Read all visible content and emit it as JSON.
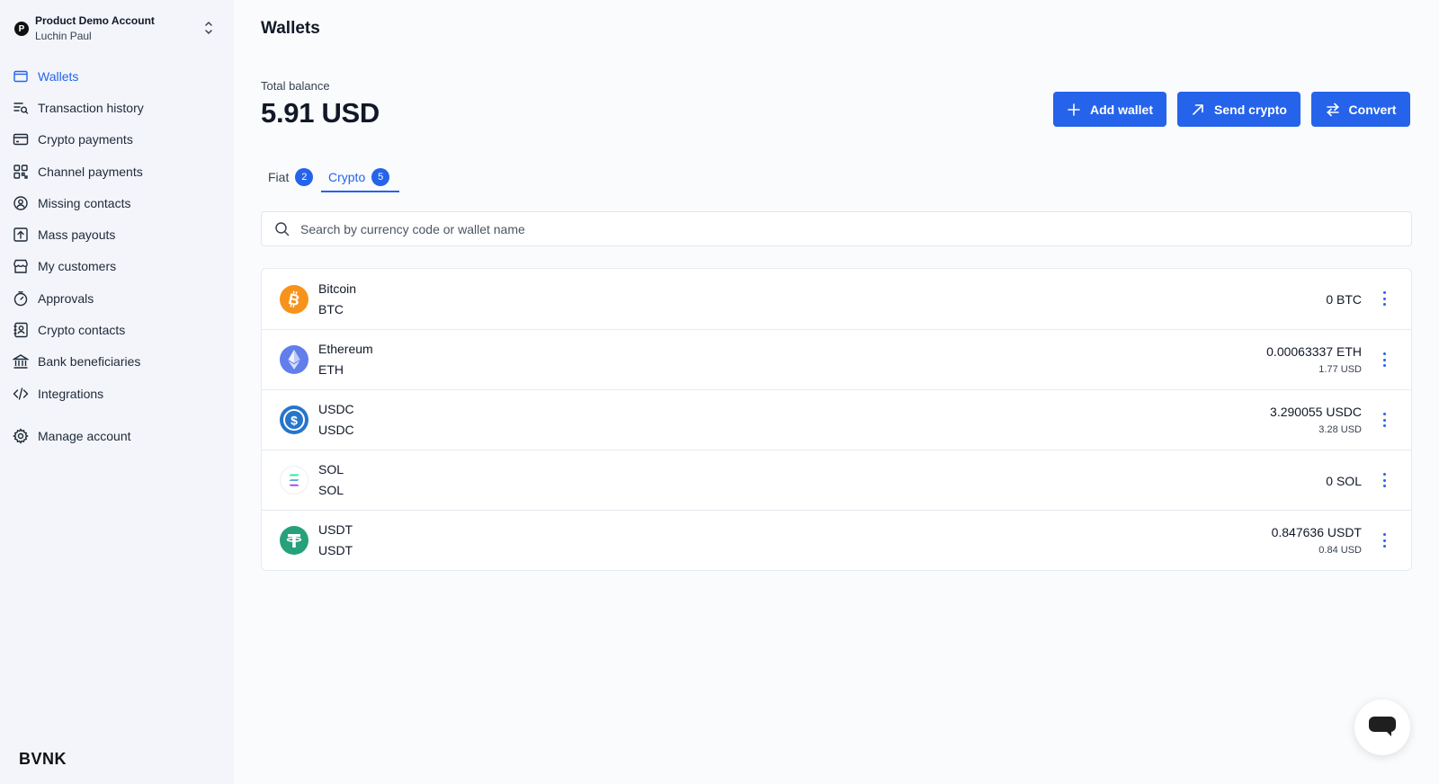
{
  "account": {
    "badge": "P",
    "name": "Product Demo Account",
    "user": "Luchin Paul"
  },
  "sidebar": {
    "items": [
      {
        "label": "Wallets",
        "icon": "wallet-icon",
        "active": true
      },
      {
        "label": "Transaction history",
        "icon": "transaction-history-icon"
      },
      {
        "label": "Crypto payments",
        "icon": "card-icon"
      },
      {
        "label": "Channel payments",
        "icon": "qr-grid-icon"
      },
      {
        "label": "Missing contacts",
        "icon": "contact-search-icon"
      },
      {
        "label": "Mass payouts",
        "icon": "upload-box-icon"
      },
      {
        "label": "My customers",
        "icon": "store-icon"
      },
      {
        "label": "Approvals",
        "icon": "timer-icon"
      },
      {
        "label": "Crypto contacts",
        "icon": "contact-book-icon"
      },
      {
        "label": "Bank beneficiaries",
        "icon": "bank-icon"
      },
      {
        "label": "Integrations",
        "icon": "code-icon"
      }
    ],
    "manage": {
      "label": "Manage account",
      "icon": "gear-icon"
    },
    "brand": "BVNK"
  },
  "header": {
    "title": "Wallets",
    "balance_label": "Total balance",
    "balance_value": "5.91 USD"
  },
  "actions": {
    "add_wallet": "Add wallet",
    "send_crypto": "Send crypto",
    "convert": "Convert"
  },
  "tabs": [
    {
      "label": "Fiat",
      "count": "2"
    },
    {
      "label": "Crypto",
      "count": "5",
      "active": true
    }
  ],
  "search": {
    "placeholder": "Search by currency code or wallet name"
  },
  "wallets": [
    {
      "name": "Bitcoin",
      "code": "BTC",
      "amount": "0 BTC",
      "fiat": "",
      "icon": "bitcoin-icon",
      "color": "#f7931a"
    },
    {
      "name": "Ethereum",
      "code": "ETH",
      "amount": "0.00063337 ETH",
      "fiat": "1.77 USD",
      "icon": "ethereum-icon",
      "color": "#627eea"
    },
    {
      "name": "USDC",
      "code": "USDC",
      "amount": "3.290055 USDC",
      "fiat": "3.28 USD",
      "icon": "usdc-icon",
      "color": "#2775ca"
    },
    {
      "name": "SOL",
      "code": "SOL",
      "amount": "0 SOL",
      "fiat": "",
      "icon": "solana-icon",
      "color": "#9945ff"
    },
    {
      "name": "USDT",
      "code": "USDT",
      "amount": "0.847636 USDT",
      "fiat": "0.84 USD",
      "icon": "tether-icon",
      "color": "#26a17b"
    }
  ],
  "colors": {
    "accent": "#2563eb",
    "sidebar_bg": "#f3f5fb",
    "page_bg": "#fafbfd"
  }
}
